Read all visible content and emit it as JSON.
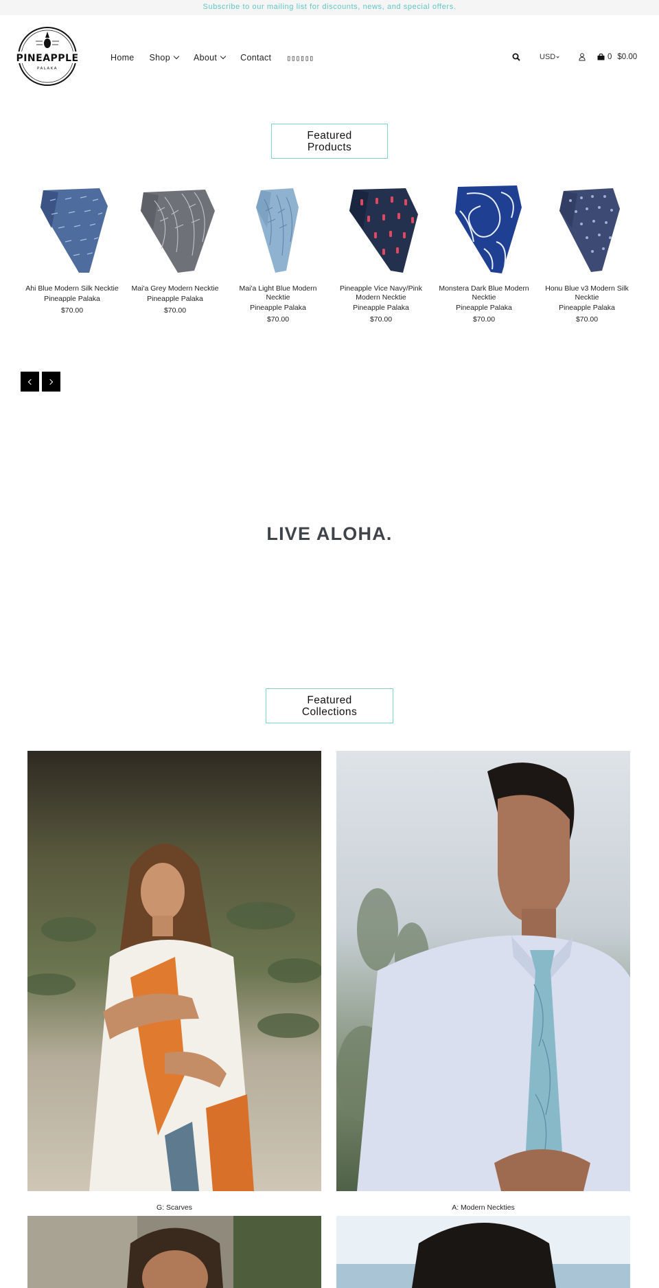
{
  "announcement": "Subscribe to our mailing list for discounts, news, and special offers.",
  "brand": {
    "name": "PINEAPPLE",
    "sub": "PALAKA"
  },
  "nav": {
    "home": "Home",
    "shop": "Shop",
    "about": "About",
    "contact": "Contact",
    "glyphs": "▯▯▯▯▯▯"
  },
  "header": {
    "currency": "USD",
    "cart_count": "0",
    "cart_total": "$0.00"
  },
  "featured_products": {
    "heading_line1": "Featured",
    "heading_line2": "Products",
    "items": [
      {
        "name": "Ahi Blue Modern Silk Necktie",
        "vendor": "Pineapple Palaka",
        "price": "$70.00"
      },
      {
        "name": "Mai'a Grey Modern Necktie",
        "vendor": "Pineapple Palaka",
        "price": "$70.00"
      },
      {
        "name": "Mai'a Light Blue Modern Necktie",
        "vendor": "Pineapple Palaka",
        "price": "$70.00"
      },
      {
        "name": "Pineapple Vice Navy/Pink Modern Necktie",
        "vendor": "Pineapple Palaka",
        "price": "$70.00"
      },
      {
        "name": "Monstera Dark Blue Modern Necktie",
        "vendor": "Pineapple Palaka",
        "price": "$70.00"
      },
      {
        "name": "Honu Blue v3 Modern Silk Necktie",
        "vendor": "Pineapple Palaka",
        "price": "$70.00"
      }
    ]
  },
  "tagline": "LIVE ALOHA.",
  "featured_collections": {
    "heading_line1": "Featured",
    "heading_line2": "Collections",
    "items": [
      {
        "label": "G: Scarves"
      },
      {
        "label": "A: Modern Neckties"
      }
    ]
  },
  "colors": {
    "accent": "#61c6c3",
    "border": "#7fd1cc",
    "tagline": "#3f444b"
  }
}
